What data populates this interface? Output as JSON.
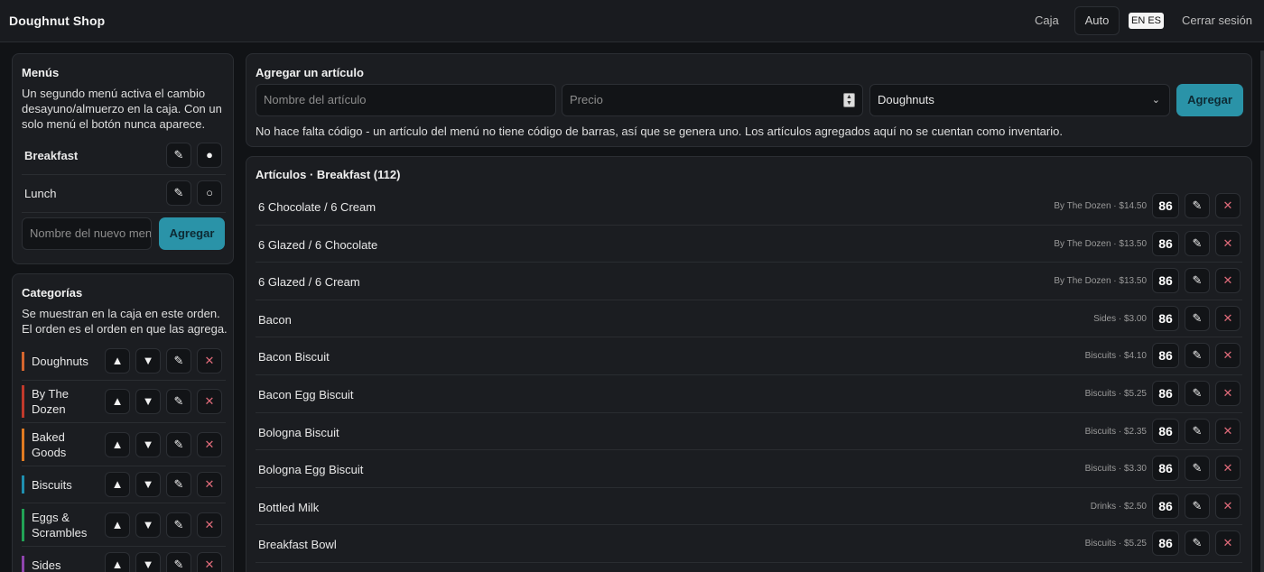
{
  "header": {
    "brand": "Doughnut Shop",
    "nav": {
      "caja": "Caja",
      "auto": "Auto",
      "lang": "EN ES",
      "logout": "Cerrar sesión"
    }
  },
  "menus": {
    "title": "Menús",
    "description": "Un segundo menú activa el cambio desayuno/almuerzo en la caja. Con un solo menú el botón nunca aparece.",
    "items": [
      {
        "label": "Breakfast",
        "active": true
      },
      {
        "label": "Lunch",
        "active": false
      }
    ],
    "new_menu_placeholder": "Nombre del nuevo menú",
    "add_label": "Agregar"
  },
  "categories": {
    "title": "Categorías",
    "description": "Se muestran en la caja en este orden. El orden es el orden en que las agrega.",
    "items": [
      {
        "label": "Doughnuts",
        "color": "#d4652e"
      },
      {
        "label": "By The Dozen",
        "color": "#c0392b"
      },
      {
        "label": "Baked Goods",
        "color": "#e07b22"
      },
      {
        "label": "Biscuits",
        "color": "#1f8fb0"
      },
      {
        "label": "Eggs & Scrambles",
        "color": "#22a356"
      },
      {
        "label": "Sides",
        "color": "#8e44ad"
      }
    ]
  },
  "add_item": {
    "title": "Agregar un artículo",
    "name_placeholder": "Nombre del artículo",
    "price_placeholder": "Precio",
    "category_selected": "Doughnuts",
    "add_label": "Agregar",
    "note": "No hace falta código - un artículo del menú no tiene código de barras, así que se genera uno. Los artículos agregados aquí no se cuentan como inventario."
  },
  "articles": {
    "title": "Artículos · Breakfast (112)",
    "badge_label": "86",
    "icons": {
      "edit": "pencil-icon",
      "delete": "close-icon",
      "up": "arrow-up-icon",
      "down": "arrow-down-icon"
    },
    "items": [
      {
        "name": "6 Chocolate / 6 Cream",
        "meta": "By The Dozen · $14.50"
      },
      {
        "name": "6 Glazed / 6 Chocolate",
        "meta": "By The Dozen · $13.50"
      },
      {
        "name": "6 Glazed / 6 Cream",
        "meta": "By The Dozen · $13.50"
      },
      {
        "name": "Bacon",
        "meta": "Sides · $3.00"
      },
      {
        "name": "Bacon Biscuit",
        "meta": "Biscuits · $4.10"
      },
      {
        "name": "Bacon Egg Biscuit",
        "meta": "Biscuits · $5.25"
      },
      {
        "name": "Bologna Biscuit",
        "meta": "Biscuits · $2.35"
      },
      {
        "name": "Bologna Egg Biscuit",
        "meta": "Biscuits · $3.30"
      },
      {
        "name": "Bottled Milk",
        "meta": "Drinks · $2.50"
      },
      {
        "name": "Breakfast Bowl",
        "meta": "Biscuits · $5.25"
      }
    ]
  }
}
